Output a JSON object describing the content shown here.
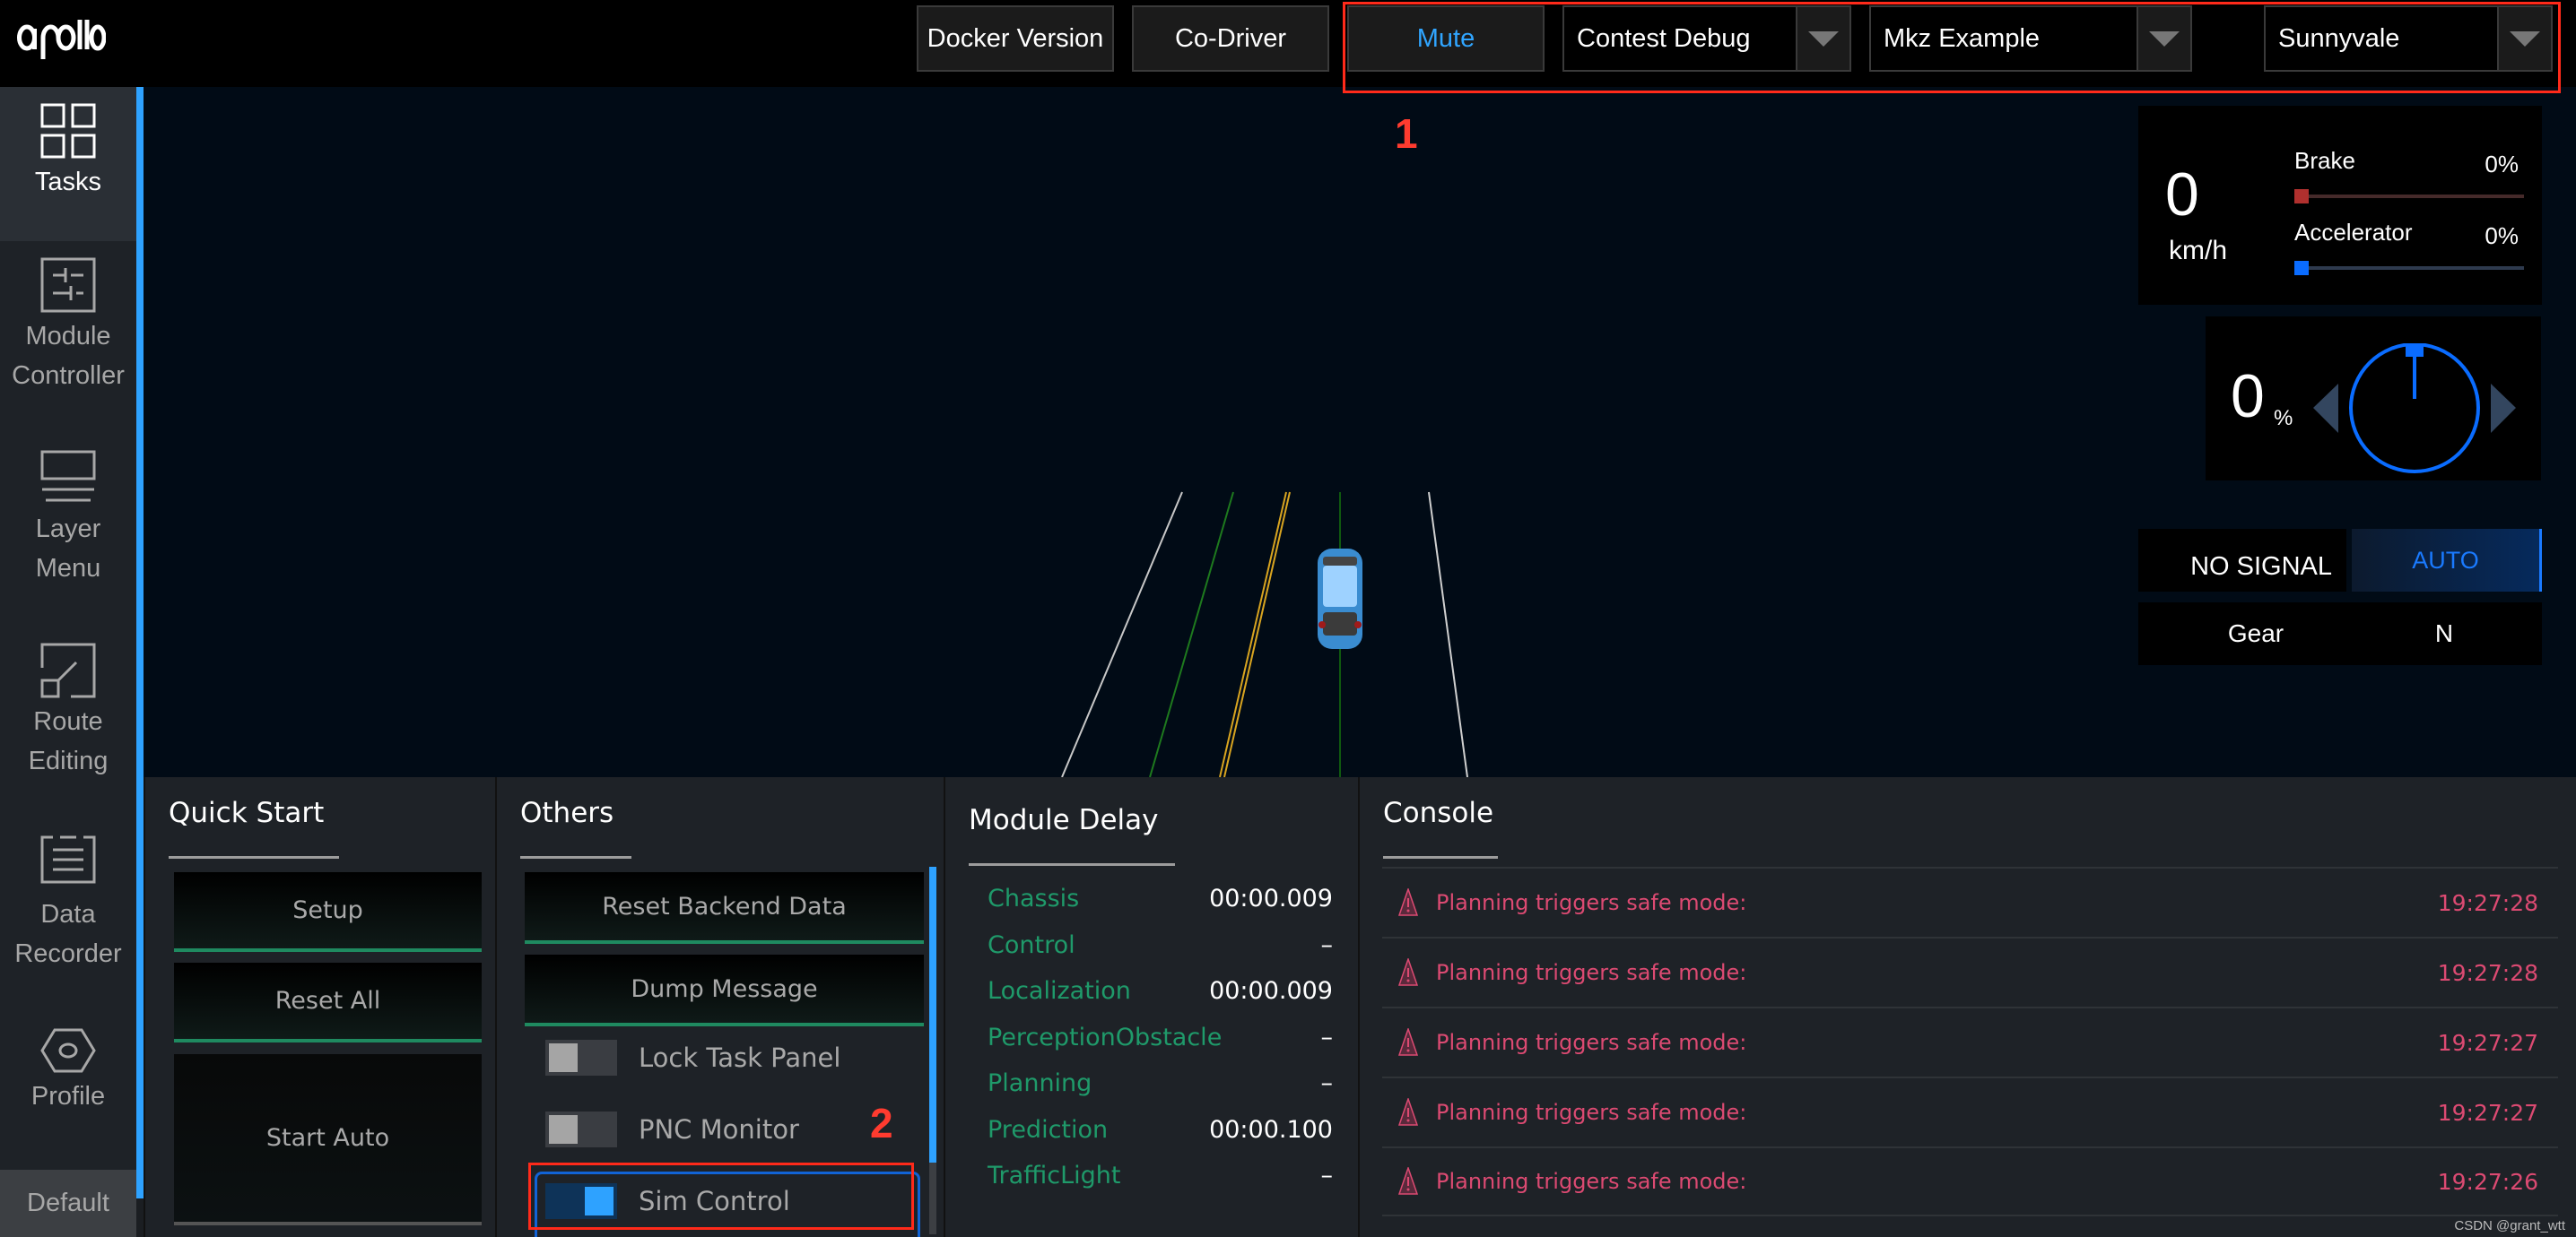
{
  "app": {
    "logo_text": "apollo"
  },
  "header": {
    "buttons": {
      "docker_version": "Docker Version",
      "co_driver": "Co-Driver",
      "mute": "Mute"
    },
    "selects": {
      "mode": "Contest Debug",
      "vehicle": "Mkz Example",
      "map": "Sunnyvale"
    }
  },
  "annotations": {
    "box1": "1",
    "box2": "2"
  },
  "sidebar": {
    "items": [
      {
        "label_line1": "Tasks",
        "label_line2": "",
        "icon": "grid-icon",
        "active": true
      },
      {
        "label_line1": "Module",
        "label_line2": "Controller",
        "icon": "module-controller-icon"
      },
      {
        "label_line1": "Layer",
        "label_line2": "Menu",
        "icon": "layer-menu-icon"
      },
      {
        "label_line1": "Route",
        "label_line2": "Editing",
        "icon": "route-editing-icon"
      },
      {
        "label_line1": "Data",
        "label_line2": "Recorder",
        "icon": "data-recorder-icon"
      },
      {
        "label_line1": "Profile",
        "label_line2": "",
        "icon": "profile-hexagon-icon"
      }
    ],
    "footer": "Default"
  },
  "dashboard": {
    "speed": {
      "value": "0",
      "unit": "km/h"
    },
    "brake": {
      "label": "Brake",
      "percent_text": "0%",
      "value_percent": 0,
      "color": "#b0302e"
    },
    "accelerator": {
      "label": "Accelerator",
      "percent_text": "0%",
      "value_percent": 0,
      "color": "#0a6cff"
    },
    "steering": {
      "value": "0",
      "unit": "%",
      "angle_percent": 0,
      "color": "#0a6cff"
    },
    "signal": "NO SIGNAL",
    "driving_mode": "AUTO",
    "gear": {
      "label": "Gear",
      "value": "N"
    }
  },
  "quick_start": {
    "title": "Quick Start",
    "buttons": {
      "setup": "Setup",
      "reset_all": "Reset All",
      "start_auto": "Start Auto"
    }
  },
  "others": {
    "title": "Others",
    "buttons": {
      "reset_backend": "Reset Backend Data",
      "dump_message": "Dump Message"
    },
    "toggles": [
      {
        "label": "Lock Task Panel",
        "on": false
      },
      {
        "label": "PNC Monitor",
        "on": false
      },
      {
        "label": "Sim Control",
        "on": true
      }
    ]
  },
  "module_delay": {
    "title": "Module Delay",
    "rows": [
      {
        "name": "Chassis",
        "value": "00:00.009"
      },
      {
        "name": "Control",
        "value": "–"
      },
      {
        "name": "Localization",
        "value": "00:00.009"
      },
      {
        "name": "PerceptionObstacle",
        "value": "–"
      },
      {
        "name": "Planning",
        "value": "–"
      },
      {
        "name": "Prediction",
        "value": "00:00.100"
      },
      {
        "name": "TrafficLight",
        "value": "–"
      }
    ]
  },
  "console": {
    "title": "Console",
    "messages": [
      {
        "text": "Planning triggers safe mode:",
        "time": "19:27:28",
        "level": "warning"
      },
      {
        "text": "Planning triggers safe mode:",
        "time": "19:27:28",
        "level": "warning"
      },
      {
        "text": "Planning triggers safe mode:",
        "time": "19:27:27",
        "level": "warning"
      },
      {
        "text": "Planning triggers safe mode:",
        "time": "19:27:27",
        "level": "warning"
      },
      {
        "text": "Planning triggers safe mode:",
        "time": "19:27:26",
        "level": "warning"
      }
    ]
  },
  "watermark": "CSDN @grant_wtt"
}
